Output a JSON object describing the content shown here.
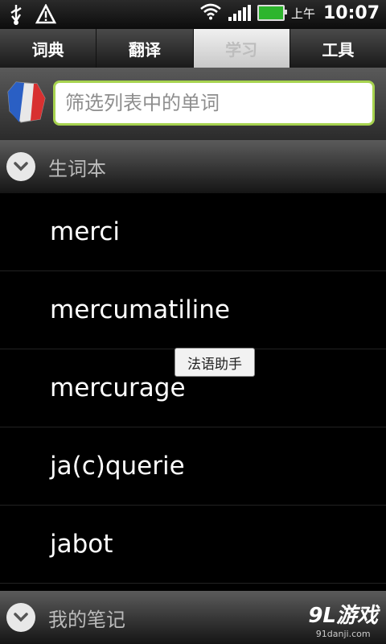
{
  "statusbar": {
    "ampm": "上午",
    "time": "10:07"
  },
  "tabs": [
    {
      "label": "词典"
    },
    {
      "label": "翻译"
    },
    {
      "label": "学习"
    },
    {
      "label": "工具"
    }
  ],
  "search": {
    "placeholder": "筛选列表中的单词"
  },
  "groups": {
    "vocab": {
      "label": "生词本"
    },
    "notes": {
      "label": "我的笔记"
    }
  },
  "words": [
    {
      "text": "merci"
    },
    {
      "text": "mercumatiline"
    },
    {
      "text": "mercurage"
    },
    {
      "text": "ja(c)querie"
    },
    {
      "text": "jabot"
    }
  ],
  "tooltip": {
    "text": "法语助手"
  },
  "watermark": {
    "main": "9L游戏",
    "sub": "91danji.com"
  },
  "colors": {
    "accent": "#a7d34f",
    "battery": "#2db52d"
  }
}
